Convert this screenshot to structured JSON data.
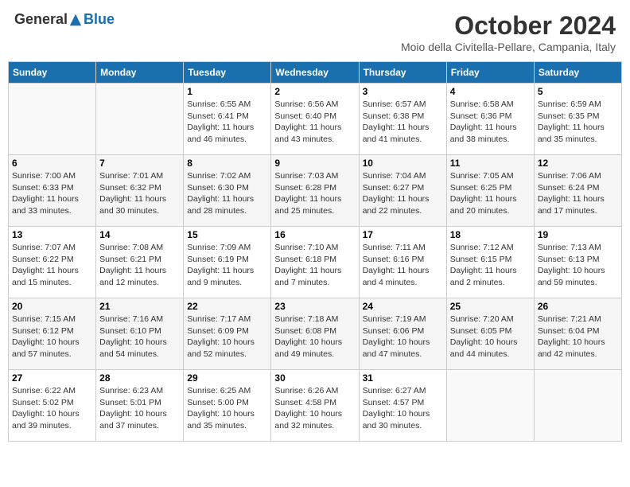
{
  "header": {
    "logo": {
      "general": "General",
      "blue": "Blue"
    },
    "title": "October 2024",
    "subtitle": "Moio della Civitella-Pellare, Campania, Italy"
  },
  "calendar": {
    "days_of_week": [
      "Sunday",
      "Monday",
      "Tuesday",
      "Wednesday",
      "Thursday",
      "Friday",
      "Saturday"
    ],
    "weeks": [
      [
        {
          "day": "",
          "info": ""
        },
        {
          "day": "",
          "info": ""
        },
        {
          "day": "1",
          "info": "Sunrise: 6:55 AM\nSunset: 6:41 PM\nDaylight: 11 hours and 46 minutes."
        },
        {
          "day": "2",
          "info": "Sunrise: 6:56 AM\nSunset: 6:40 PM\nDaylight: 11 hours and 43 minutes."
        },
        {
          "day": "3",
          "info": "Sunrise: 6:57 AM\nSunset: 6:38 PM\nDaylight: 11 hours and 41 minutes."
        },
        {
          "day": "4",
          "info": "Sunrise: 6:58 AM\nSunset: 6:36 PM\nDaylight: 11 hours and 38 minutes."
        },
        {
          "day": "5",
          "info": "Sunrise: 6:59 AM\nSunset: 6:35 PM\nDaylight: 11 hours and 35 minutes."
        }
      ],
      [
        {
          "day": "6",
          "info": "Sunrise: 7:00 AM\nSunset: 6:33 PM\nDaylight: 11 hours and 33 minutes."
        },
        {
          "day": "7",
          "info": "Sunrise: 7:01 AM\nSunset: 6:32 PM\nDaylight: 11 hours and 30 minutes."
        },
        {
          "day": "8",
          "info": "Sunrise: 7:02 AM\nSunset: 6:30 PM\nDaylight: 11 hours and 28 minutes."
        },
        {
          "day": "9",
          "info": "Sunrise: 7:03 AM\nSunset: 6:28 PM\nDaylight: 11 hours and 25 minutes."
        },
        {
          "day": "10",
          "info": "Sunrise: 7:04 AM\nSunset: 6:27 PM\nDaylight: 11 hours and 22 minutes."
        },
        {
          "day": "11",
          "info": "Sunrise: 7:05 AM\nSunset: 6:25 PM\nDaylight: 11 hours and 20 minutes."
        },
        {
          "day": "12",
          "info": "Sunrise: 7:06 AM\nSunset: 6:24 PM\nDaylight: 11 hours and 17 minutes."
        }
      ],
      [
        {
          "day": "13",
          "info": "Sunrise: 7:07 AM\nSunset: 6:22 PM\nDaylight: 11 hours and 15 minutes."
        },
        {
          "day": "14",
          "info": "Sunrise: 7:08 AM\nSunset: 6:21 PM\nDaylight: 11 hours and 12 minutes."
        },
        {
          "day": "15",
          "info": "Sunrise: 7:09 AM\nSunset: 6:19 PM\nDaylight: 11 hours and 9 minutes."
        },
        {
          "day": "16",
          "info": "Sunrise: 7:10 AM\nSunset: 6:18 PM\nDaylight: 11 hours and 7 minutes."
        },
        {
          "day": "17",
          "info": "Sunrise: 7:11 AM\nSunset: 6:16 PM\nDaylight: 11 hours and 4 minutes."
        },
        {
          "day": "18",
          "info": "Sunrise: 7:12 AM\nSunset: 6:15 PM\nDaylight: 11 hours and 2 minutes."
        },
        {
          "day": "19",
          "info": "Sunrise: 7:13 AM\nSunset: 6:13 PM\nDaylight: 10 hours and 59 minutes."
        }
      ],
      [
        {
          "day": "20",
          "info": "Sunrise: 7:15 AM\nSunset: 6:12 PM\nDaylight: 10 hours and 57 minutes."
        },
        {
          "day": "21",
          "info": "Sunrise: 7:16 AM\nSunset: 6:10 PM\nDaylight: 10 hours and 54 minutes."
        },
        {
          "day": "22",
          "info": "Sunrise: 7:17 AM\nSunset: 6:09 PM\nDaylight: 10 hours and 52 minutes."
        },
        {
          "day": "23",
          "info": "Sunrise: 7:18 AM\nSunset: 6:08 PM\nDaylight: 10 hours and 49 minutes."
        },
        {
          "day": "24",
          "info": "Sunrise: 7:19 AM\nSunset: 6:06 PM\nDaylight: 10 hours and 47 minutes."
        },
        {
          "day": "25",
          "info": "Sunrise: 7:20 AM\nSunset: 6:05 PM\nDaylight: 10 hours and 44 minutes."
        },
        {
          "day": "26",
          "info": "Sunrise: 7:21 AM\nSunset: 6:04 PM\nDaylight: 10 hours and 42 minutes."
        }
      ],
      [
        {
          "day": "27",
          "info": "Sunrise: 6:22 AM\nSunset: 5:02 PM\nDaylight: 10 hours and 39 minutes."
        },
        {
          "day": "28",
          "info": "Sunrise: 6:23 AM\nSunset: 5:01 PM\nDaylight: 10 hours and 37 minutes."
        },
        {
          "day": "29",
          "info": "Sunrise: 6:25 AM\nSunset: 5:00 PM\nDaylight: 10 hours and 35 minutes."
        },
        {
          "day": "30",
          "info": "Sunrise: 6:26 AM\nSunset: 4:58 PM\nDaylight: 10 hours and 32 minutes."
        },
        {
          "day": "31",
          "info": "Sunrise: 6:27 AM\nSunset: 4:57 PM\nDaylight: 10 hours and 30 minutes."
        },
        {
          "day": "",
          "info": ""
        },
        {
          "day": "",
          "info": ""
        }
      ]
    ]
  }
}
